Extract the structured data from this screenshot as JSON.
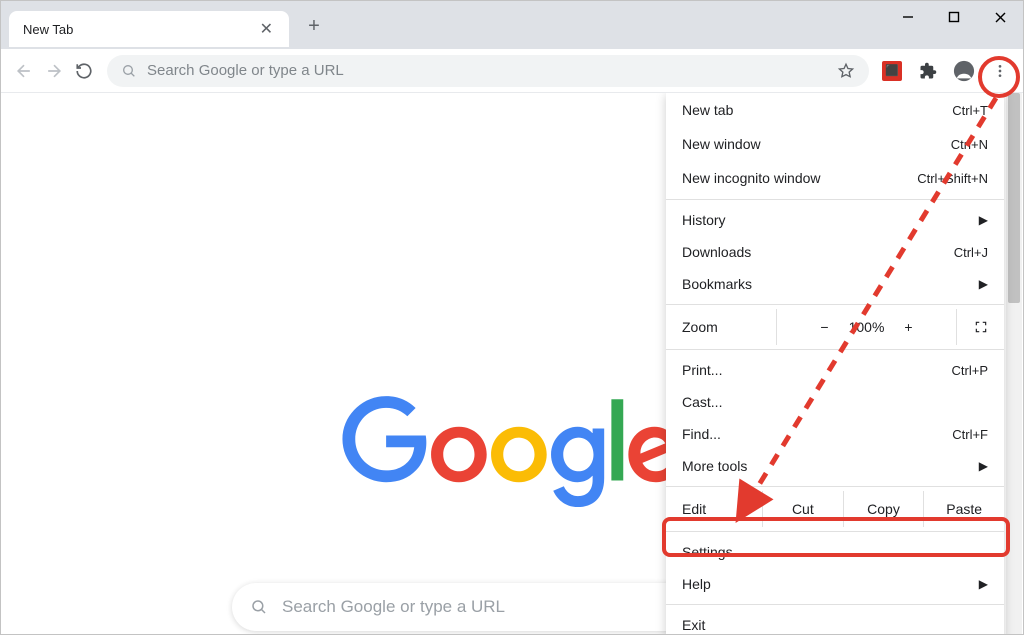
{
  "tab": {
    "title": "New Tab"
  },
  "omnibox": {
    "placeholder": "Search Google or type a URL"
  },
  "menu": {
    "new_tab": {
      "label": "New tab",
      "shortcut": "Ctrl+T"
    },
    "new_window": {
      "label": "New window",
      "shortcut": "Ctrl+N"
    },
    "incognito": {
      "label": "New incognito window",
      "shortcut": "Ctrl+Shift+N"
    },
    "history": {
      "label": "History"
    },
    "downloads": {
      "label": "Downloads",
      "shortcut": "Ctrl+J"
    },
    "bookmarks": {
      "label": "Bookmarks"
    },
    "zoom": {
      "label": "Zoom",
      "minus": "−",
      "value": "100%",
      "plus": "+"
    },
    "print": {
      "label": "Print...",
      "shortcut": "Ctrl+P"
    },
    "cast": {
      "label": "Cast..."
    },
    "find": {
      "label": "Find...",
      "shortcut": "Ctrl+F"
    },
    "more_tools": {
      "label": "More tools"
    },
    "edit": {
      "label": "Edit",
      "cut": "Cut",
      "copy": "Copy",
      "paste": "Paste"
    },
    "settings": {
      "label": "Settings"
    },
    "help": {
      "label": "Help"
    },
    "exit": {
      "label": "Exit"
    }
  },
  "search": {
    "placeholder": "Search Google or type a URL"
  },
  "logo_text": "Google"
}
